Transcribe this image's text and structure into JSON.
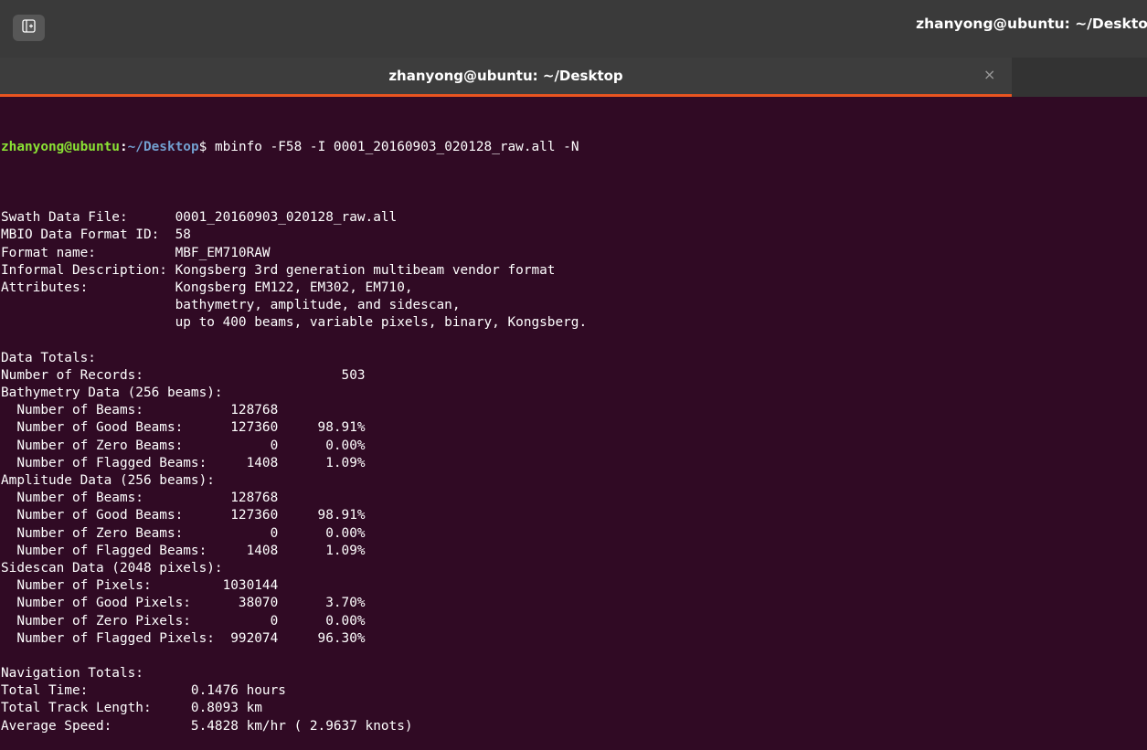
{
  "window": {
    "title": "zhanyong@ubuntu: ~/Desktop"
  },
  "tab": {
    "label": "zhanyong@ubuntu: ~/Desktop",
    "close_glyph": "×",
    "new_tab_icon": "new-tab-icon"
  },
  "prompt": {
    "user_host": "zhanyong@ubuntu",
    "separator": ":",
    "path": "~/Desktop",
    "symbol": "$ ",
    "command": "mbinfo -F58 -I 0001_20160903_020128_raw.all -N"
  },
  "colors": {
    "terminal_bg": "#300a24",
    "titlebar_bg": "#3a3a3a",
    "tab_accent": "#e95420",
    "prompt_user": "#8ae234",
    "prompt_path": "#729fcf"
  },
  "output_lines": [
    "",
    "Swath Data File:      0001_20160903_020128_raw.all",
    "MBIO Data Format ID:  58",
    "Format name:          MBF_EM710RAW",
    "Informal Description: Kongsberg 3rd generation multibeam vendor format",
    "Attributes:           Kongsberg EM122, EM302, EM710,",
    "                      bathymetry, amplitude, and sidescan,",
    "                      up to 400 beams, variable pixels, binary, Kongsberg.",
    "",
    "Data Totals:",
    "Number of Records:                         503",
    "Bathymetry Data (256 beams):",
    "  Number of Beams:           128768",
    "  Number of Good Beams:      127360     98.91%",
    "  Number of Zero Beams:           0      0.00%",
    "  Number of Flagged Beams:     1408      1.09%",
    "Amplitude Data (256 beams):",
    "  Number of Beams:           128768",
    "  Number of Good Beams:      127360     98.91%",
    "  Number of Zero Beams:           0      0.00%",
    "  Number of Flagged Beams:     1408      1.09%",
    "Sidescan Data (2048 pixels):",
    "  Number of Pixels:         1030144",
    "  Number of Good Pixels:      38070      3.70%",
    "  Number of Zero Pixels:          0      0.00%",
    "  Number of Flagged Pixels:  992074     96.30%",
    "",
    "Navigation Totals:",
    "Total Time:             0.1476 hours",
    "Total Track Length:     0.8093 km",
    "Average Speed:          5.4828 km/hr ( 2.9637 knots)"
  ]
}
